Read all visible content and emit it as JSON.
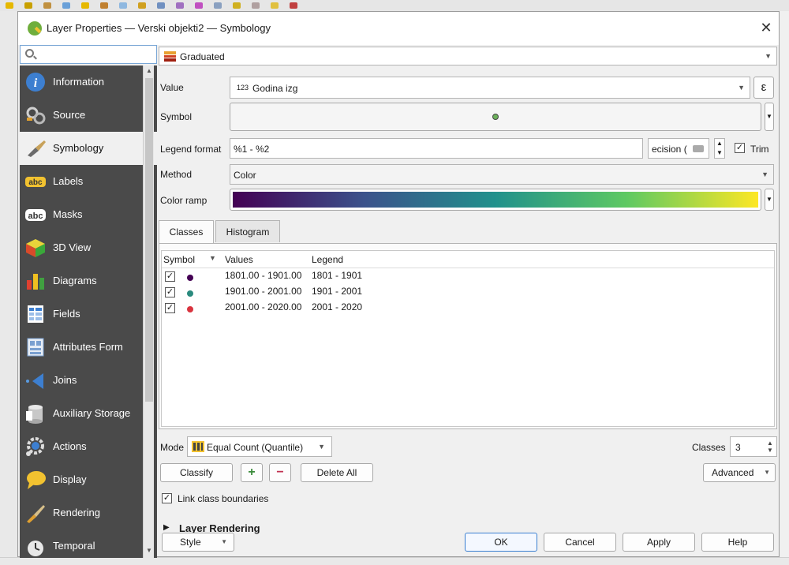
{
  "dialog": {
    "title": "Layer Properties — Verski objekti2 — Symbology",
    "close": "✕"
  },
  "search": {
    "value": "",
    "placeholder": ""
  },
  "sidebar": {
    "items": [
      {
        "label": "Information",
        "icon": "info-icon"
      },
      {
        "label": "Source",
        "icon": "source-icon"
      },
      {
        "label": "Symbology",
        "icon": "symbology-brush-icon"
      },
      {
        "label": "Labels",
        "icon": "labels-icon"
      },
      {
        "label": "Masks",
        "icon": "masks-icon"
      },
      {
        "label": "3D View",
        "icon": "3d-view-icon"
      },
      {
        "label": "Diagrams",
        "icon": "diagrams-icon"
      },
      {
        "label": "Fields",
        "icon": "fields-icon"
      },
      {
        "label": "Attributes Form",
        "icon": "attributes-form-icon"
      },
      {
        "label": "Joins",
        "icon": "joins-icon"
      },
      {
        "label": "Auxiliary Storage",
        "icon": "auxiliary-storage-icon"
      },
      {
        "label": "Actions",
        "icon": "actions-gear-icon"
      },
      {
        "label": "Display",
        "icon": "display-bubble-icon"
      },
      {
        "label": "Rendering",
        "icon": "rendering-brush-icon"
      },
      {
        "label": "Temporal",
        "icon": "temporal-clock-icon"
      }
    ],
    "active": "Symbology"
  },
  "renderer": {
    "value": "Graduated"
  },
  "form": {
    "value_label": "Value",
    "value_field": "Godina izg",
    "value_field_type": "123",
    "expression_btn": "ε",
    "symbol_label": "Symbol",
    "legend_format_label": "Legend format",
    "legend_format_value": "%1 - %2",
    "precision_text": "ecision (",
    "trim_label": "Trim",
    "method_label": "Method",
    "method_value": "Color",
    "color_ramp_label": "Color ramp",
    "color_ramp_colors": [
      "#440154",
      "#3b528b",
      "#21918c",
      "#5ec962",
      "#fde725"
    ]
  },
  "tabs": [
    {
      "label": "Classes",
      "active": true
    },
    {
      "label": "Histogram",
      "active": false
    }
  ],
  "classes_table": {
    "headers": [
      "Symbol",
      "Values",
      "Legend"
    ],
    "rows": [
      {
        "checked": true,
        "color": "#440154",
        "values": "1801.00 - 1901.00",
        "legend": "1801 - 1901"
      },
      {
        "checked": true,
        "color": "#2a8a7e",
        "values": "1901.00 - 2001.00",
        "legend": "1901 - 2001"
      },
      {
        "checked": true,
        "color": "#d9343f",
        "values": "2001.00 - 2020.00",
        "legend": "2001 - 2020"
      }
    ]
  },
  "mode": {
    "label": "Mode",
    "value": "Equal Count (Quantile)"
  },
  "classes_count": {
    "label": "Classes",
    "value": "3"
  },
  "buttons": {
    "classify": "Classify",
    "add_class": "+",
    "remove_class": "−",
    "delete_all": "Delete All",
    "advanced": "Advanced"
  },
  "link_class_boundaries": {
    "label": "Link class boundaries",
    "checked": true
  },
  "layer_rendering": {
    "label": "Layer Rendering"
  },
  "footer": {
    "style": "Style",
    "ok": "OK",
    "cancel": "Cancel",
    "apply": "Apply",
    "help": "Help"
  }
}
